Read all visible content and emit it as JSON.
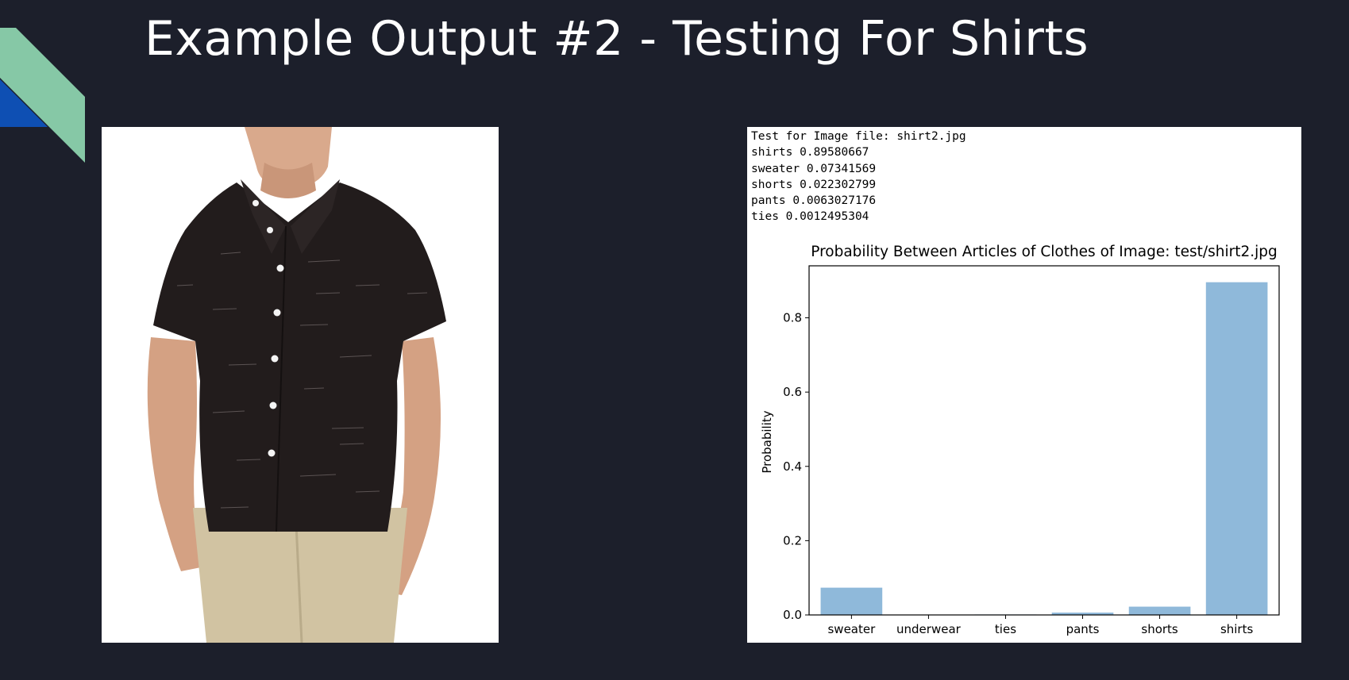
{
  "slide": {
    "title": "Example Output #2 - Testing For Shirts"
  },
  "colors": {
    "background": "#1c1f2b",
    "accent_green": "#86c8a6",
    "accent_blue": "#0e4fb3",
    "bar": "#8fb9da"
  },
  "photo": {
    "icon": "shirt-model-photo"
  },
  "console": {
    "lines": [
      "Test for Image file: shirt2.jpg",
      "shirts 0.89580667",
      "sweater 0.07341569",
      "shorts 0.022302799",
      "pants 0.0063027176",
      "ties 0.0012495304"
    ]
  },
  "chart_data": {
    "type": "bar",
    "title": "Probability Between Articles of Clothes of Image: test/shirt2.jpg",
    "xlabel": "",
    "ylabel": "Probability",
    "categories": [
      "sweater",
      "underwear",
      "ties",
      "pants",
      "shorts",
      "shirts"
    ],
    "values": [
      0.07341569,
      0.0,
      0.0012495304,
      0.0063027176,
      0.022302799,
      0.89580667
    ],
    "ylim": [
      0,
      0.94
    ],
    "yticks": [
      "0.0",
      "0.2",
      "0.4",
      "0.6",
      "0.8"
    ],
    "ytick_values": [
      0,
      0.2,
      0.4,
      0.6,
      0.8
    ],
    "grid": false,
    "legend": "none"
  }
}
